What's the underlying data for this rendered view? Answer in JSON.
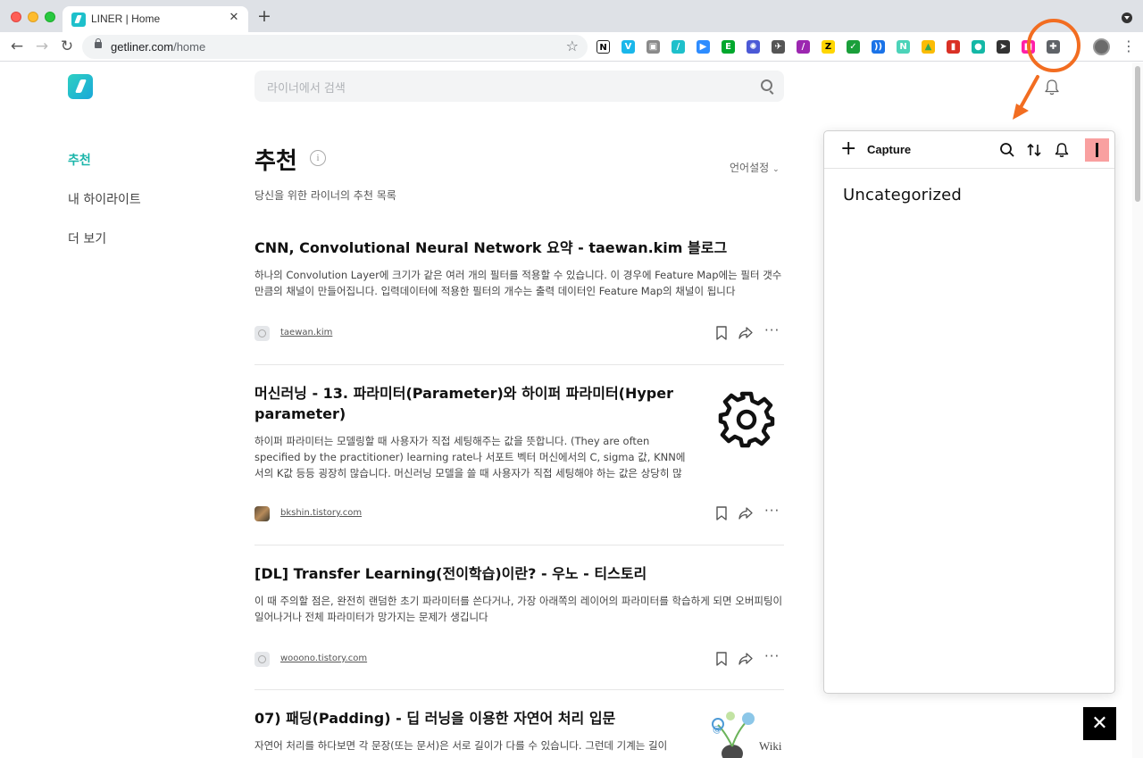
{
  "browser": {
    "tab_title": "LINER | Home",
    "url_domain": "getliner.com",
    "url_path": "/home",
    "extensions": [
      {
        "name": "notion-icon",
        "label": "N",
        "color": "#ffffff",
        "text": "#000000"
      },
      {
        "name": "vimeo-icon",
        "label": "V",
        "color": "#1ab7ea",
        "text": "#ffffff"
      },
      {
        "name": "camera-icon",
        "label": "▣",
        "color": "#8a8a8a",
        "text": "#ffffff"
      },
      {
        "name": "liner-ext-icon",
        "label": "/",
        "color": "#1ec0cb",
        "text": "#ffffff"
      },
      {
        "name": "zoom-icon",
        "label": "▶",
        "color": "#2d8cff",
        "text": "#ffffff"
      },
      {
        "name": "evernote-icon",
        "label": "E",
        "color": "#00a82d",
        "text": "#ffffff"
      },
      {
        "name": "sun-icon",
        "label": "✺",
        "color": "#4b59d6",
        "text": "#ffffff"
      },
      {
        "name": "bird-icon",
        "label": "✈",
        "color": "#555555",
        "text": "#ffffff"
      },
      {
        "name": "feather-icon",
        "label": "/",
        "color": "#9c27b0",
        "text": "#ffffff"
      },
      {
        "name": "z-icon",
        "label": "Z",
        "color": "#ffd600",
        "text": "#000000"
      },
      {
        "name": "check-icon",
        "label": "✓",
        "color": "#1a9f3a",
        "text": "#ffffff"
      },
      {
        "name": "wave-icon",
        "label": "))",
        "color": "#1a73e8",
        "text": "#ffffff"
      },
      {
        "name": "n-icon",
        "label": "N",
        "color": "#4cd3b9",
        "text": "#ffffff"
      },
      {
        "name": "drive-icon",
        "label": "▲",
        "color": "#fbbc04",
        "text": "#34a853"
      },
      {
        "name": "chart-icon",
        "label": "▮",
        "color": "#d93025",
        "text": "#ffffff"
      },
      {
        "name": "dot-icon",
        "label": "●",
        "color": "#14b8a6",
        "text": "#ffffff"
      },
      {
        "name": "send-icon",
        "label": "➤",
        "color": "#333333",
        "text": "#ffffff"
      },
      {
        "name": "capture-ext-icon",
        "label": "■",
        "color": "#ff1fa8",
        "text": "#ffffff"
      },
      {
        "name": "puzzle-icon",
        "label": "✚",
        "color": "#5f6368",
        "text": "#ffffff"
      }
    ]
  },
  "page": {
    "search_placeholder": "라이너에서 검색",
    "nav": [
      {
        "label": "추천"
      },
      {
        "label": "내 하이라이트"
      },
      {
        "label": "더 보기"
      }
    ],
    "title": "추천",
    "language_setting": "언어설정",
    "subtitle": "당신을 위한 라이너의 추천 목록",
    "articles": [
      {
        "title": "CNN, Convolutional Neural Network 요약 - taewan.kim 블로그",
        "body": "하나의 Convolution Layer에 크기가 같은 여러 개의 필터를 적용할 수 있습니다. 이 경우에 Feature Map에는 필터 갯수만큼의 채널이 만들어집니다. 입력데이터에 적용한 필터의 개수는 출력 데이터인 Feature Map의 채널이 됩니다",
        "source": "taewan.kim"
      },
      {
        "title": "머신러닝 - 13. 파라미터(Parameter)와 하이퍼 파라미터(Hyper parameter)",
        "body": "하이퍼 파라미터는 모델링할 때 사용자가 직접 세팅해주는 값을 뜻합니다. (They are often specified by the practitioner) learning rate나 서포트 벡터 머신에서의 C, sigma 값, KNN에서의 K값 등등 굉장히 많습니다. 머신러닝 모델을 쓸 때 사용자가 직접 세팅해야 하는 값은 상당히 많습...",
        "source": "bkshin.tistory.com"
      },
      {
        "title": "[DL] Transfer Learning(전이학습)이란? - 우노 - 티스토리",
        "body": "이 때 주의할 점은, 완전히 랜덤한 초기 파라미터를 쓴다거나, 가장 아래쪽의 레이어의 파라미터를 학습하게 되면 오버피팅이 일어나거나 전체 파라미터가 망가지는 문제가 생깁니다",
        "source": "wooono.tistory.com"
      },
      {
        "title": "07) 패딩(Padding) - 딥 러닝을 이용한 자연어 처리 입문",
        "body": "자연어 처리를 하다보면 각 문장(또는 문서)은 서로 길이가 다를 수 있습니다. 그런데 기계는 길이",
        "thumb_text": "Wiki"
      }
    ]
  },
  "popup": {
    "capture_label": "Capture",
    "section": "Uncategorized",
    "brand_color": "#f9a0a0"
  },
  "annotation_color": "#f26d21"
}
